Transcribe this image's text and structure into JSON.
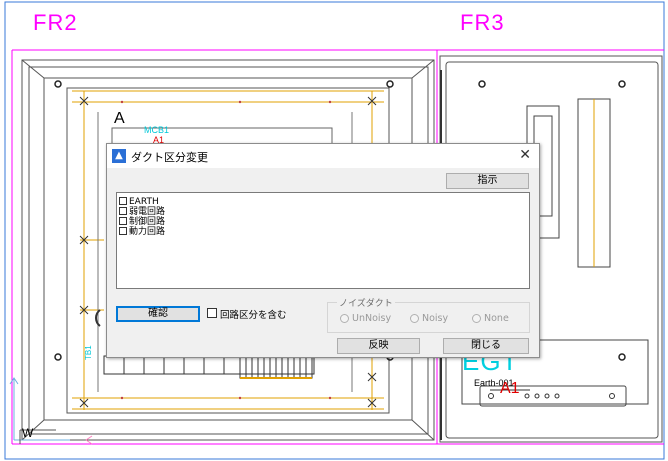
{
  "drawing": {
    "frame_left": "FR2",
    "frame_right": "FR3",
    "label_a": "A",
    "label_mcb": "MCB1",
    "label_a1_top": "A1",
    "label_egt": "EGT",
    "label_earth": "Earth-001",
    "label_a1_bottom": "A1",
    "label_tb": "TB1",
    "label_w": "W"
  },
  "dialog": {
    "title": "ダクト区分変更",
    "close_symbol": "✕",
    "instruct_button": "指示",
    "list_items": [
      "EARTH",
      "弱電回路",
      "制御回路",
      "動力回路"
    ],
    "confirm_button": "確認",
    "include_circuit_label": "回路区分を含む",
    "noise_group_label": "ノイズダクト",
    "radio_options": [
      "UnNoisy",
      "Noisy",
      "None"
    ],
    "apply_button": "反映",
    "close_button": "閉じる"
  },
  "colors": {
    "magenta": "#ff00ff",
    "cyan": "#00d0e0",
    "red": "#e00000",
    "orange": "#e0a000",
    "cad_gray": "#555555"
  }
}
